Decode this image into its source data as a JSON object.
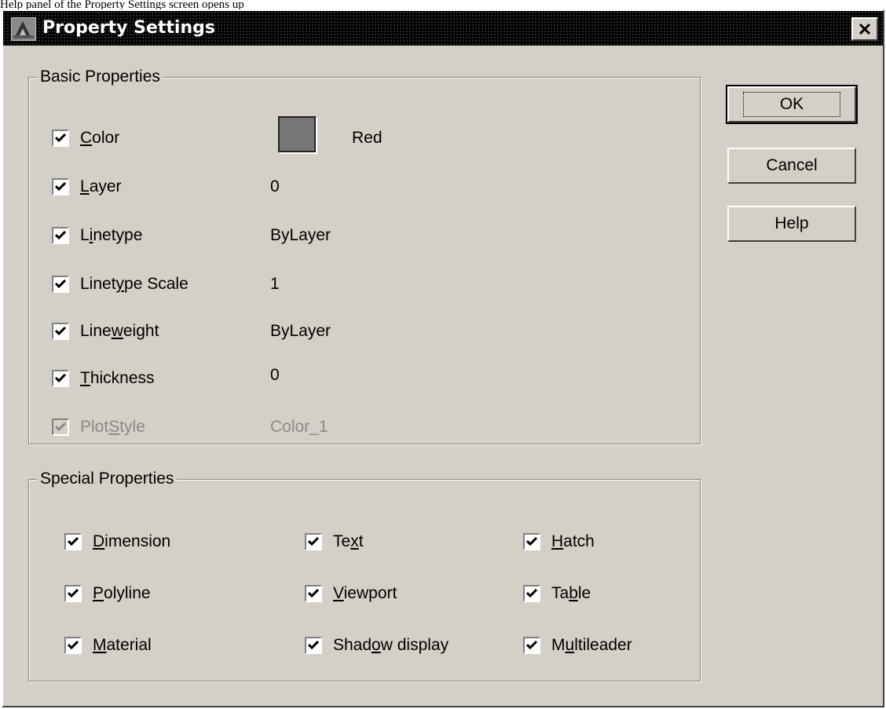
{
  "caption": "Help panel of the Property Settings screen opens up",
  "window": {
    "title": "Property Settings",
    "close_glyph": "✕"
  },
  "colors": {
    "titlebar": "#000000",
    "face": "#d4d0c8",
    "swatch": "#777777"
  },
  "basic": {
    "legend": "Basic Properties",
    "items": [
      {
        "label": "Color",
        "mnemonic": "C",
        "value": "Red",
        "checked": true,
        "disabled": false
      },
      {
        "label": "Layer",
        "mnemonic": "L",
        "value": "0",
        "checked": true,
        "disabled": false
      },
      {
        "label": "Linetype",
        "mnemonic": "i",
        "value": "ByLayer",
        "checked": true,
        "disabled": false
      },
      {
        "label": "Linetype Scale",
        "mnemonic": "y",
        "value": "1",
        "checked": true,
        "disabled": false
      },
      {
        "label": "Lineweight",
        "mnemonic": "w",
        "value": "ByLayer",
        "checked": true,
        "disabled": false
      },
      {
        "label": "Thickness",
        "mnemonic": "T",
        "value": "0",
        "checked": true,
        "disabled": false
      },
      {
        "label": "PlotStyle",
        "mnemonic": "S",
        "value": "Color_1",
        "checked": true,
        "disabled": true
      }
    ]
  },
  "special": {
    "legend": "Special Properties",
    "items": [
      {
        "label": "Dimension",
        "mnemonic": "D",
        "checked": true
      },
      {
        "label": "Text",
        "mnemonic": "x",
        "checked": true
      },
      {
        "label": "Hatch",
        "mnemonic": "H",
        "checked": true
      },
      {
        "label": "Polyline",
        "mnemonic": "P",
        "checked": true
      },
      {
        "label": "Viewport",
        "mnemonic": "V",
        "checked": true
      },
      {
        "label": "Table",
        "mnemonic": "b",
        "checked": true
      },
      {
        "label": "Material",
        "mnemonic": "M",
        "checked": true
      },
      {
        "label": "Shadow display",
        "mnemonic": "o",
        "checked": true
      },
      {
        "label": "Multileader",
        "mnemonic": "u",
        "checked": true
      }
    ]
  },
  "buttons": {
    "ok": "OK",
    "cancel": "Cancel",
    "help": "Help"
  },
  "icons": {
    "app": "autocad-app-icon",
    "close": "close-icon",
    "check": "checkmark-icon"
  }
}
